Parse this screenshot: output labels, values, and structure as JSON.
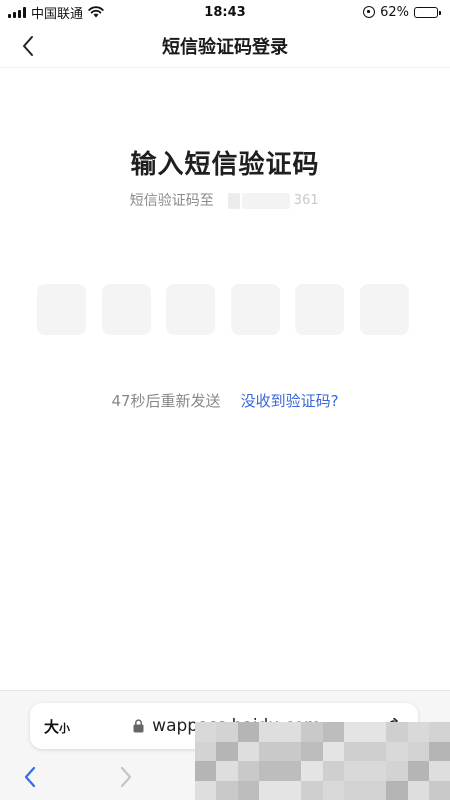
{
  "status_bar": {
    "carrier": "中国联通",
    "time": "18:43",
    "battery": "62%",
    "battery_level": 0.62
  },
  "nav": {
    "title": "短信验证码登录"
  },
  "main": {
    "title": "输入短信验证码",
    "subtitle_prefix": "短信验证码至",
    "phone_suffix": "361",
    "code_length": 6
  },
  "resend": {
    "countdown": "47秒后重新发送",
    "no_code_link": "没收到验证码?"
  },
  "browser": {
    "text_size_big": "大",
    "text_size_small": "小",
    "url": "wappass.baidu.com"
  },
  "colors": {
    "accent": "#3a66d8",
    "box_bg": "#f4f4f4",
    "muted_text": "#888888"
  }
}
